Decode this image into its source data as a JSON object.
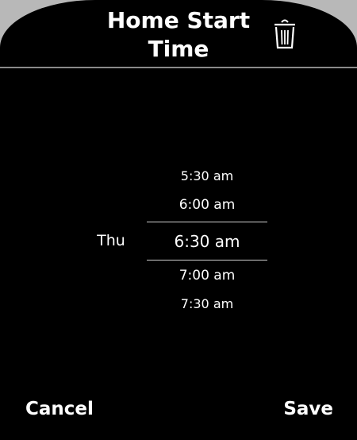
{
  "header": {
    "title": "Home Start\nTime"
  },
  "icons": {
    "delete": "trash-icon"
  },
  "picker": {
    "day": "Thu",
    "times": [
      {
        "label": "5:30 am",
        "selected": false
      },
      {
        "label": "6:00 am",
        "selected": false
      },
      {
        "label": "6:30 am",
        "selected": true
      },
      {
        "label": "7:00 am",
        "selected": false
      },
      {
        "label": "7:30 am",
        "selected": false
      }
    ]
  },
  "footer": {
    "cancel_label": "Cancel",
    "save_label": "Save"
  }
}
